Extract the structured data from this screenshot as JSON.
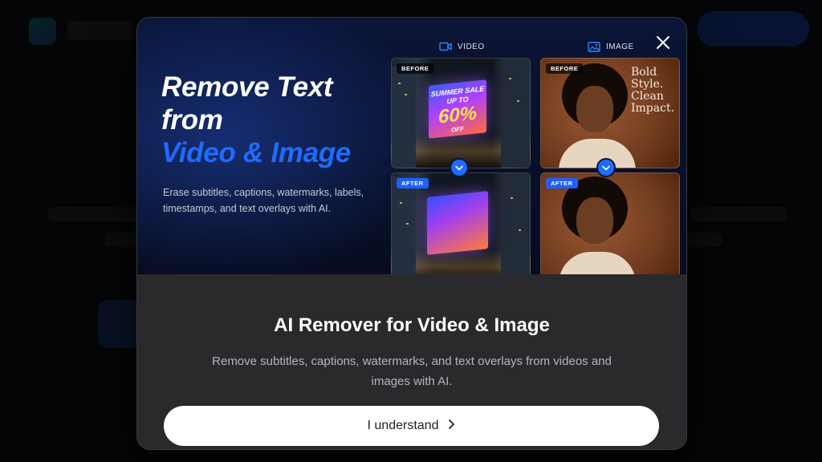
{
  "modal": {
    "hero_title_line1": "Remove Text",
    "hero_title_line2": "from",
    "hero_title_line3": "Video & Image",
    "hero_subtitle": "Erase subtitles, captions, watermarks, labels, timestamps, and text overlays with AI.",
    "media_tabs": {
      "video": "VIDEO",
      "image": "IMAGE"
    },
    "panels": {
      "before_label": "BEFORE",
      "after_label": "AFTER",
      "billboard_text": {
        "line1": "SUMMER SALE",
        "line2": "UP TO",
        "line3": "60%",
        "line4": "OFF"
      },
      "portrait_overlay": {
        "line1": "Bold",
        "line2": "Style.",
        "line3": "Clean",
        "line4": "Impact."
      }
    },
    "title": "AI Remover for Video & Image",
    "description": "Remove subtitles, captions, watermarks, and text overlays from videos and images with AI.",
    "button_label": "I understand"
  },
  "colors": {
    "accent": "#1f6bff",
    "modal_bg": "#2a2a2c",
    "hero_bg": "#0a1436",
    "button_bg": "#ffffff"
  },
  "icons": [
    "video-icon",
    "image-icon",
    "close-icon",
    "chevron-down-icon",
    "chevron-right-icon"
  ]
}
